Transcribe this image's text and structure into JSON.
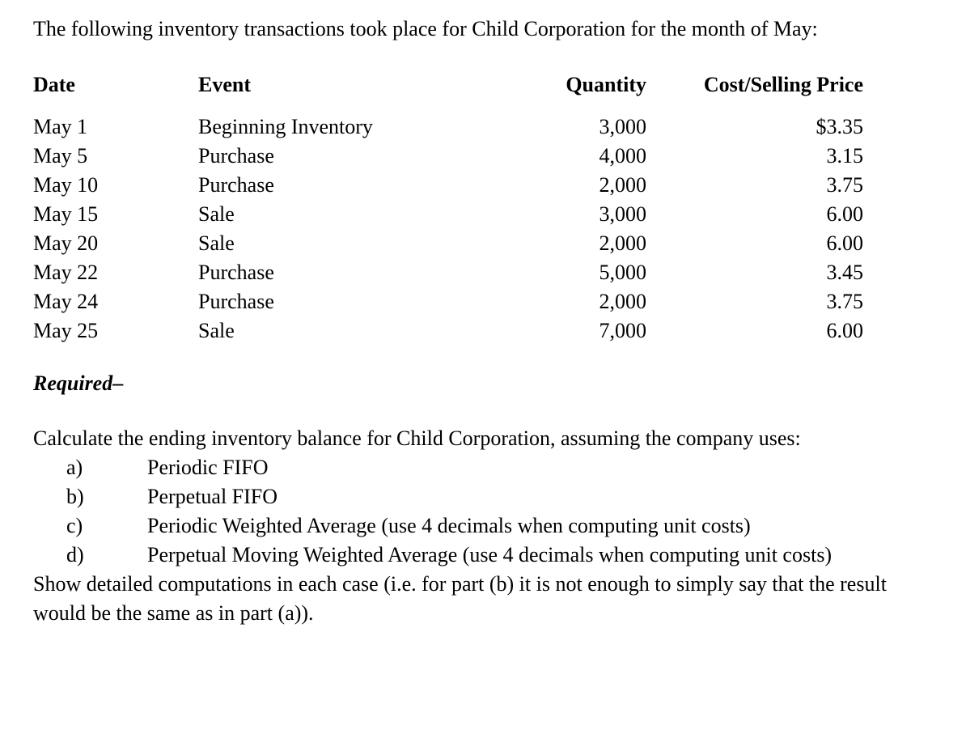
{
  "document": {
    "intro_paragraph": "The following inventory transactions took place for Child Corporation for the month of May:",
    "required_label": "Required",
    "required_dash": "–",
    "calculate_paragraph": "Calculate the ending inventory balance for Child Corporation, assuming the company uses:",
    "closing_paragraph": "Show detailed computations in each case (i.e. for part (b) it is not enough to simply say that the result would be the same as in part (a))."
  },
  "table": {
    "headers": {
      "date": "Date",
      "event": "Event",
      "quantity": "Quantity",
      "price": "Cost/Selling Price"
    },
    "rows": [
      {
        "date": "May 1",
        "event": "Beginning Inventory",
        "quantity": "3,000",
        "price": "$3.35"
      },
      {
        "date": "May 5",
        "event": "Purchase",
        "quantity": "4,000",
        "price": "3.15"
      },
      {
        "date": "May 10",
        "event": "Purchase",
        "quantity": "2,000",
        "price": "3.75"
      },
      {
        "date": "May 15",
        "event": "Sale",
        "quantity": "3,000",
        "price": "6.00"
      },
      {
        "date": "May 20",
        "event": "Sale",
        "quantity": "2,000",
        "price": "6.00"
      },
      {
        "date": "May 22",
        "event": "Purchase",
        "quantity": "5,000",
        "price": "3.45"
      },
      {
        "date": "May 24",
        "event": "Purchase",
        "quantity": "2,000",
        "price": "3.75"
      },
      {
        "date": "May 25",
        "event": "Sale",
        "quantity": "7,000",
        "price": "6.00"
      }
    ]
  },
  "options": [
    {
      "marker": "a)",
      "text": "Periodic FIFO"
    },
    {
      "marker": "b)",
      "text": "Perpetual FIFO"
    },
    {
      "marker": "c)",
      "text": "Periodic Weighted Average (use 4 decimals when computing unit costs)"
    },
    {
      "marker": "d)",
      "text": "Perpetual Moving Weighted Average (use 4 decimals when computing unit costs)"
    }
  ],
  "colors": {
    "page_background": "#ffffff",
    "text": "#000000"
  }
}
